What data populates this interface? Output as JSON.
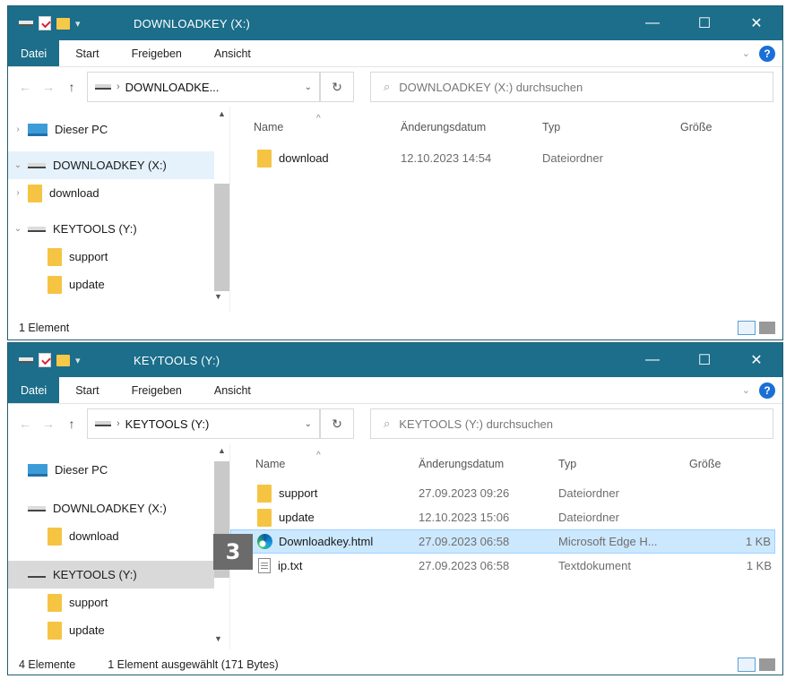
{
  "ribbon": {
    "file": "Datei",
    "start": "Start",
    "share": "Freigeben",
    "view": "Ansicht"
  },
  "colors": {
    "titlebar": "#1c6e8a",
    "selection": "#cce8ff",
    "badge": "#6b6b6b"
  },
  "window_top": {
    "title": "DOWNLOADKEY (X:)",
    "address_path": "DOWNLOADKE...",
    "search_placeholder": "DOWNLOADKEY (X:) durchsuchen",
    "tree": [
      {
        "label": "Dieser PC"
      },
      {
        "label": "DOWNLOADKEY (X:)"
      },
      {
        "label": "download"
      },
      {
        "label": "KEYTOOLS (Y:)"
      },
      {
        "label": "support"
      },
      {
        "label": "update"
      }
    ],
    "columns": {
      "name": "Name",
      "date": "Änderungsdatum",
      "type": "Typ",
      "size": "Größe"
    },
    "rows": [
      {
        "name": "download",
        "date": "12.10.2023 14:54",
        "type": "Dateiordner",
        "size": ""
      }
    ],
    "status": "1 Element"
  },
  "window_bottom": {
    "title": "KEYTOOLS (Y:)",
    "address_path": "KEYTOOLS (Y:)",
    "search_placeholder": "KEYTOOLS (Y:) durchsuchen",
    "tree": [
      {
        "label": "Dieser PC"
      },
      {
        "label": "DOWNLOADKEY (X:)"
      },
      {
        "label": "download"
      },
      {
        "label": "KEYTOOLS (Y:)"
      },
      {
        "label": "support"
      },
      {
        "label": "update"
      }
    ],
    "columns": {
      "name": "Name",
      "date": "Änderungsdatum",
      "type": "Typ",
      "size": "Größe"
    },
    "rows": [
      {
        "name": "support",
        "date": "27.09.2023 09:26",
        "type": "Dateiordner",
        "size": ""
      },
      {
        "name": "update",
        "date": "12.10.2023 15:06",
        "type": "Dateiordner",
        "size": ""
      },
      {
        "name": "Downloadkey.html",
        "date": "27.09.2023 06:58",
        "type": "Microsoft Edge H...",
        "size": "1 KB"
      },
      {
        "name": "ip.txt",
        "date": "27.09.2023 06:58",
        "type": "Textdokument",
        "size": "1 KB"
      }
    ],
    "status": "4 Elemente",
    "selection_info": "1 Element ausgewählt (171 Bytes)"
  },
  "badge": "3"
}
